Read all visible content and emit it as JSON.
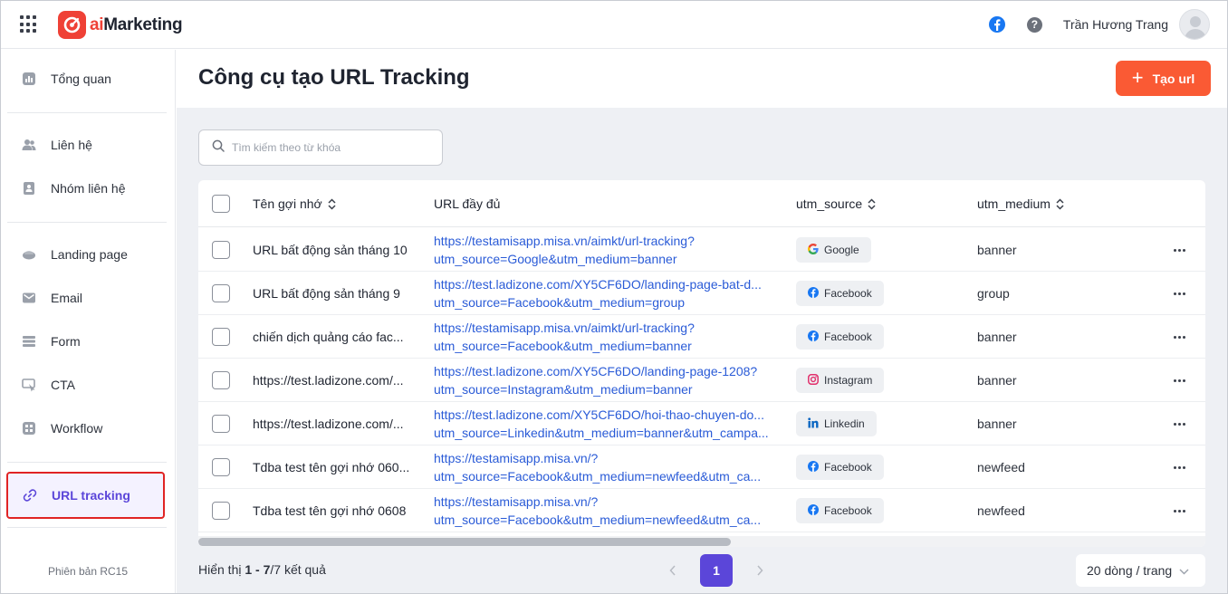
{
  "header": {
    "app_name_prefix": "ai",
    "app_name_suffix": "Marketing",
    "user_name": "Trần Hương Trang"
  },
  "sidebar": {
    "items": [
      {
        "label": "Tổng quan",
        "icon": "chart-icon"
      },
      {
        "label": "Liên hệ",
        "icon": "contacts-icon"
      },
      {
        "label": "Nhóm liên hệ",
        "icon": "contact-group-icon"
      },
      {
        "label": "Landing page",
        "icon": "landing-page-icon"
      },
      {
        "label": "Email",
        "icon": "email-icon"
      },
      {
        "label": "Form",
        "icon": "form-icon"
      },
      {
        "label": "CTA",
        "icon": "cta-icon"
      },
      {
        "label": "Workflow",
        "icon": "workflow-icon"
      },
      {
        "label": "URL tracking",
        "icon": "link-icon",
        "active": true
      }
    ],
    "version": "Phiên bản RC15"
  },
  "page": {
    "title": "Công cụ tạo URL Tracking",
    "create_button": "Tạo url",
    "search_placeholder": "Tìm kiếm theo từ khóa"
  },
  "table": {
    "columns": {
      "name": "Tên gợi nhớ",
      "url": "URL đầy đủ",
      "source": "utm_source",
      "medium": "utm_medium"
    },
    "rows": [
      {
        "name": "URL bất động sản tháng 10",
        "url_line1": "https://testamisapp.misa.vn/aimkt/url-tracking?",
        "url_line2": "utm_source=Google&utm_medium=banner",
        "source": "Google",
        "medium": "banner"
      },
      {
        "name": "URL bất động sản tháng 9",
        "url_line1": "https://test.ladizone.com/XY5CF6DO/landing-page-bat-d...",
        "url_line2": "utm_source=Facebook&utm_medium=group",
        "source": "Facebook",
        "medium": "group"
      },
      {
        "name": "chiến dịch quảng cáo fac...",
        "url_line1": "https://testamisapp.misa.vn/aimkt/url-tracking?",
        "url_line2": "utm_source=Facebook&utm_medium=banner",
        "source": "Facebook",
        "medium": "banner"
      },
      {
        "name": "https://test.ladizone.com/...",
        "url_line1": "https://test.ladizone.com/XY5CF6DO/landing-page-1208?",
        "url_line2": "utm_source=Instagram&utm_medium=banner",
        "source": "Instagram",
        "medium": "banner"
      },
      {
        "name": "https://test.ladizone.com/...",
        "url_line1": "https://test.ladizone.com/XY5CF6DO/hoi-thao-chuyen-do...",
        "url_line2": "utm_source=Linkedin&utm_medium=banner&utm_campa...",
        "source": "Linkedin",
        "medium": "banner"
      },
      {
        "name": "Tdba test tên gợi nhớ 060...",
        "url_line1": "https://testamisapp.misa.vn/?",
        "url_line2": "utm_source=Facebook&utm_medium=newfeed&utm_ca...",
        "source": "Facebook",
        "medium": "newfeed"
      },
      {
        "name": "Tdba test tên gợi nhớ 0608",
        "url_line1": "https://testamisapp.misa.vn/?",
        "url_line2": "utm_source=Facebook&utm_medium=newfeed&utm_ca...",
        "source": "Facebook",
        "medium": "newfeed"
      }
    ]
  },
  "footer": {
    "showing_prefix": "Hiển thị",
    "range": "1 - 7",
    "total": "/7 kết quả",
    "current_page": "1",
    "page_size": "20 dòng / trang"
  },
  "colors": {
    "accent": "#5b46d9",
    "create_button": "#fa5a34",
    "brand_red": "#ef4136",
    "link": "#2a5bd7",
    "active_outline": "#e02424"
  }
}
